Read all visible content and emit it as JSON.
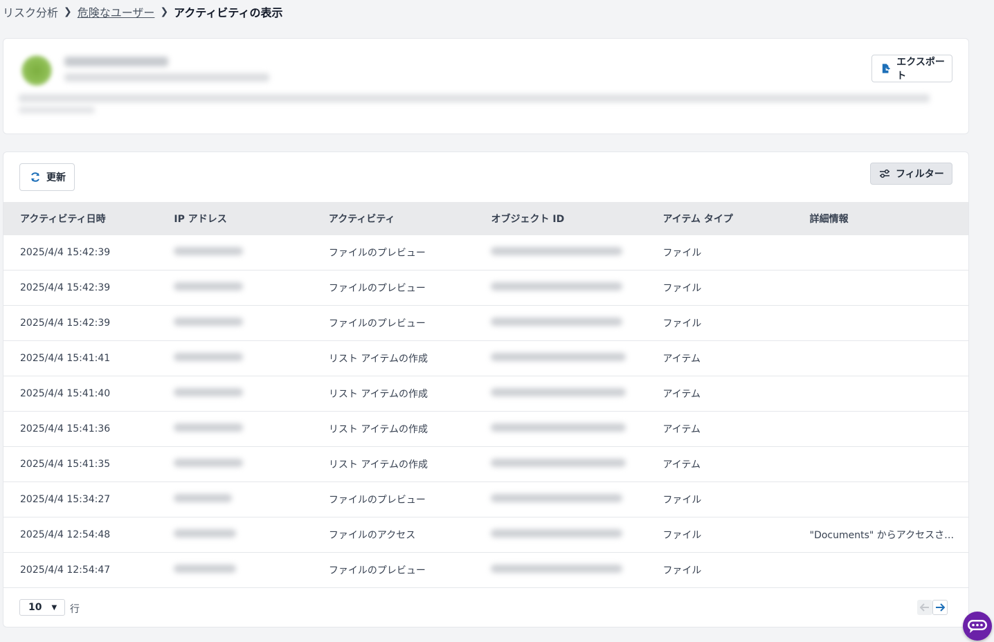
{
  "breadcrumb": {
    "items": [
      "リスク分析",
      "危険なユーザー",
      "アクティビティの表示"
    ]
  },
  "user_card": {
    "export_label": "エクスポート"
  },
  "toolbar": {
    "refresh_label": "更新",
    "filter_label": "フィルター"
  },
  "table": {
    "headers": [
      "アクティビティ日時",
      "IP アドレス",
      "アクティビティ",
      "オブジェクト ID",
      "アイテム タイプ",
      "詳細情報"
    ],
    "rows": [
      {
        "datetime": "2025/4/4 15:42:39",
        "activity": "ファイルのプレビュー",
        "item_type": "ファイル",
        "details": ""
      },
      {
        "datetime": "2025/4/4 15:42:39",
        "activity": "ファイルのプレビュー",
        "item_type": "ファイル",
        "details": ""
      },
      {
        "datetime": "2025/4/4 15:42:39",
        "activity": "ファイルのプレビュー",
        "item_type": "ファイル",
        "details": ""
      },
      {
        "datetime": "2025/4/4 15:41:41",
        "activity": "リスト アイテムの作成",
        "item_type": "アイテム",
        "details": ""
      },
      {
        "datetime": "2025/4/4 15:41:40",
        "activity": "リスト アイテムの作成",
        "item_type": "アイテム",
        "details": ""
      },
      {
        "datetime": "2025/4/4 15:41:36",
        "activity": "リスト アイテムの作成",
        "item_type": "アイテム",
        "details": ""
      },
      {
        "datetime": "2025/4/4 15:41:35",
        "activity": "リスト アイテムの作成",
        "item_type": "アイテム",
        "details": ""
      },
      {
        "datetime": "2025/4/4 15:34:27",
        "activity": "ファイルのプレビュー",
        "item_type": "ファイル",
        "details": ""
      },
      {
        "datetime": "2025/4/4 12:54:48",
        "activity": "ファイルのアクセス",
        "item_type": "ファイル",
        "details": "\"Documents\" からアクセスされ..."
      },
      {
        "datetime": "2025/4/4 12:54:47",
        "activity": "ファイルのプレビュー",
        "item_type": "ファイル",
        "details": ""
      }
    ]
  },
  "pagination": {
    "page_size": "10",
    "rows_label": "行"
  },
  "icons": {
    "export": "export-icon",
    "refresh": "refresh-icon",
    "filter": "filter-icon",
    "prev": "arrow-left-icon",
    "next": "arrow-right-icon",
    "chat": "chat-icon"
  },
  "colors": {
    "accent": "#1d6fb8",
    "chat": "#6b21a8"
  }
}
